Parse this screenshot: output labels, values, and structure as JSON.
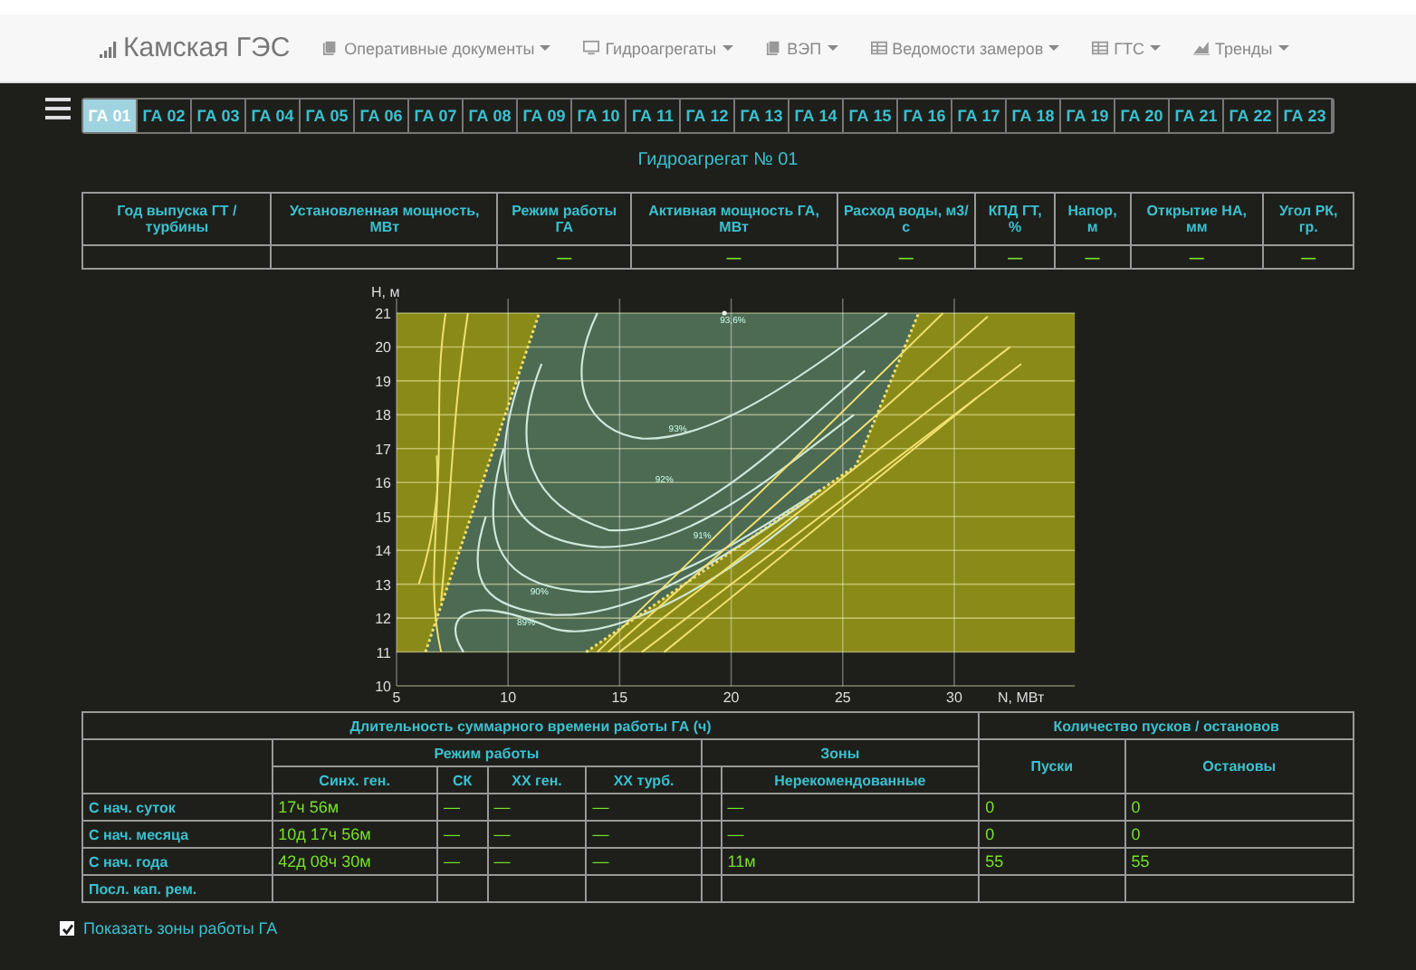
{
  "navbar": {
    "brand": "Камская ГЭС",
    "menus": [
      {
        "label": "Оперативные документы",
        "kind": "book"
      },
      {
        "label": "Гидроагрегаты",
        "kind": "monitor"
      },
      {
        "label": "ВЭП",
        "kind": "book"
      },
      {
        "label": "Ведомости замеров",
        "kind": "table"
      },
      {
        "label": "ГТС",
        "kind": "table"
      },
      {
        "label": "Тренды",
        "kind": "chart"
      }
    ]
  },
  "tabs": [
    {
      "label": "ГА 01",
      "selected": true
    },
    {
      "label": "ГА 02",
      "selected": false
    },
    {
      "label": "ГА 03",
      "selected": false
    },
    {
      "label": "ГА 04",
      "selected": false
    },
    {
      "label": "ГА 05",
      "selected": false
    },
    {
      "label": "ГА 06",
      "selected": false
    },
    {
      "label": "ГА 07",
      "selected": false
    },
    {
      "label": "ГА 08",
      "selected": false
    },
    {
      "label": "ГА 09",
      "selected": false
    },
    {
      "label": "ГА 10",
      "selected": false
    },
    {
      "label": "ГА 11",
      "selected": false
    },
    {
      "label": "ГА 12",
      "selected": false
    },
    {
      "label": "ГА 13",
      "selected": false
    },
    {
      "label": "ГА 14",
      "selected": false
    },
    {
      "label": "ГА 15",
      "selected": false
    },
    {
      "label": "ГА 16",
      "selected": false
    },
    {
      "label": "ГА 17",
      "selected": false
    },
    {
      "label": "ГА 18",
      "selected": false
    },
    {
      "label": "ГА 19",
      "selected": false
    },
    {
      "label": "ГА 20",
      "selected": false
    },
    {
      "label": "ГА 21",
      "selected": false
    },
    {
      "label": "ГА 22",
      "selected": false
    },
    {
      "label": "ГА 23",
      "selected": false
    }
  ],
  "unit_title": "Гидроагрегат № 01",
  "params_table": {
    "columns": [
      {
        "label": "Год выпуска ГТ / турбины"
      },
      {
        "label": "Установленная мощность, МВт"
      },
      {
        "label": "Режим работы ГА",
        "value": "—"
      },
      {
        "label": "Активная мощность ГА, МВт",
        "value": "—"
      },
      {
        "label": "Расход воды, м3/с",
        "value": "—"
      },
      {
        "label": "КПД ГТ, %",
        "value": "—"
      },
      {
        "label": "Напор, м",
        "value": "—"
      },
      {
        "label": "Открытие НА, мм",
        "value": "—"
      },
      {
        "label": "Угол РК, гр.",
        "value": "—"
      }
    ]
  },
  "hill_chart": {
    "ylabel": "H, м",
    "xlabel": "N, МВт",
    "xticks": [
      "5",
      "10",
      "15",
      "20",
      "25",
      "30"
    ],
    "yticks": [
      "21",
      "20",
      "19",
      "18",
      "17",
      "16",
      "15",
      "14",
      "13",
      "12",
      "11",
      "10"
    ],
    "contour_labels": [
      {
        "text": "93,6%",
        "kind": "peak"
      },
      {
        "text": "93%",
        "kind": "inner"
      },
      {
        "text": "92%",
        "kind": "inner"
      },
      {
        "text": "91%",
        "kind": "inner"
      },
      {
        "text": "90%",
        "kind": "inner"
      },
      {
        "text": "89%",
        "kind": "inner"
      }
    ]
  },
  "time_table": {
    "title": "Длительность суммарного времени работы ГА (ч)",
    "counts_title": "Количество пусков / остановов",
    "mode_group": "Режим работы",
    "mode_columns": [
      "Синх. ген.",
      "СК",
      "ХХ ген.",
      "ХХ турб."
    ],
    "zone_group": "Зоны",
    "zone_columns": [
      "Нерекомендованные"
    ],
    "count_columns": [
      "Пуски",
      "Остановы"
    ],
    "rows": [
      {
        "label": "С нач. суток",
        "sync_gen": "17ч 56м",
        "sk": "—",
        "xx_gen": "—",
        "xx_turb": "—",
        "unrecommended": "—",
        "starts": "0",
        "stops": "0"
      },
      {
        "label": "С нач. месяца",
        "sync_gen": "10д 17ч 56м",
        "sk": "—",
        "xx_gen": "—",
        "xx_turb": "—",
        "unrecommended": "—",
        "starts": "0",
        "stops": "0"
      },
      {
        "label": "С нач. года",
        "sync_gen": "42д 08ч 30м",
        "sk": "—",
        "xx_gen": "—",
        "xx_turb": "—",
        "unrecommended": "11м",
        "starts": "55",
        "stops": "55"
      },
      {
        "label": "Посл. кап. рем."
      }
    ]
  },
  "zones_toggle": {
    "label": "Показать зоны работы ГА",
    "checked": true
  }
}
